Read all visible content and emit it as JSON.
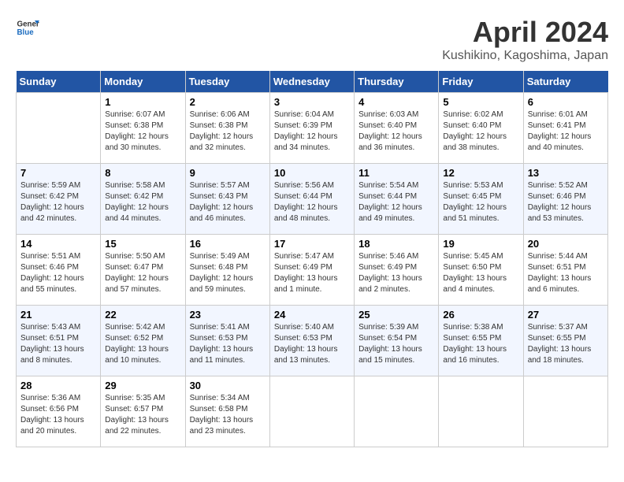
{
  "header": {
    "logo_general": "General",
    "logo_blue": "Blue",
    "title": "April 2024",
    "location": "Kushikino, Kagoshima, Japan"
  },
  "days_of_week": [
    "Sunday",
    "Monday",
    "Tuesday",
    "Wednesday",
    "Thursday",
    "Friday",
    "Saturday"
  ],
  "weeks": [
    [
      {
        "day": "",
        "info": ""
      },
      {
        "day": "1",
        "info": "Sunrise: 6:07 AM\nSunset: 6:38 PM\nDaylight: 12 hours\nand 30 minutes."
      },
      {
        "day": "2",
        "info": "Sunrise: 6:06 AM\nSunset: 6:38 PM\nDaylight: 12 hours\nand 32 minutes."
      },
      {
        "day": "3",
        "info": "Sunrise: 6:04 AM\nSunset: 6:39 PM\nDaylight: 12 hours\nand 34 minutes."
      },
      {
        "day": "4",
        "info": "Sunrise: 6:03 AM\nSunset: 6:40 PM\nDaylight: 12 hours\nand 36 minutes."
      },
      {
        "day": "5",
        "info": "Sunrise: 6:02 AM\nSunset: 6:40 PM\nDaylight: 12 hours\nand 38 minutes."
      },
      {
        "day": "6",
        "info": "Sunrise: 6:01 AM\nSunset: 6:41 PM\nDaylight: 12 hours\nand 40 minutes."
      }
    ],
    [
      {
        "day": "7",
        "info": "Sunrise: 5:59 AM\nSunset: 6:42 PM\nDaylight: 12 hours\nand 42 minutes."
      },
      {
        "day": "8",
        "info": "Sunrise: 5:58 AM\nSunset: 6:42 PM\nDaylight: 12 hours\nand 44 minutes."
      },
      {
        "day": "9",
        "info": "Sunrise: 5:57 AM\nSunset: 6:43 PM\nDaylight: 12 hours\nand 46 minutes."
      },
      {
        "day": "10",
        "info": "Sunrise: 5:56 AM\nSunset: 6:44 PM\nDaylight: 12 hours\nand 48 minutes."
      },
      {
        "day": "11",
        "info": "Sunrise: 5:54 AM\nSunset: 6:44 PM\nDaylight: 12 hours\nand 49 minutes."
      },
      {
        "day": "12",
        "info": "Sunrise: 5:53 AM\nSunset: 6:45 PM\nDaylight: 12 hours\nand 51 minutes."
      },
      {
        "day": "13",
        "info": "Sunrise: 5:52 AM\nSunset: 6:46 PM\nDaylight: 12 hours\nand 53 minutes."
      }
    ],
    [
      {
        "day": "14",
        "info": "Sunrise: 5:51 AM\nSunset: 6:46 PM\nDaylight: 12 hours\nand 55 minutes."
      },
      {
        "day": "15",
        "info": "Sunrise: 5:50 AM\nSunset: 6:47 PM\nDaylight: 12 hours\nand 57 minutes."
      },
      {
        "day": "16",
        "info": "Sunrise: 5:49 AM\nSunset: 6:48 PM\nDaylight: 12 hours\nand 59 minutes."
      },
      {
        "day": "17",
        "info": "Sunrise: 5:47 AM\nSunset: 6:49 PM\nDaylight: 13 hours\nand 1 minute."
      },
      {
        "day": "18",
        "info": "Sunrise: 5:46 AM\nSunset: 6:49 PM\nDaylight: 13 hours\nand 2 minutes."
      },
      {
        "day": "19",
        "info": "Sunrise: 5:45 AM\nSunset: 6:50 PM\nDaylight: 13 hours\nand 4 minutes."
      },
      {
        "day": "20",
        "info": "Sunrise: 5:44 AM\nSunset: 6:51 PM\nDaylight: 13 hours\nand 6 minutes."
      }
    ],
    [
      {
        "day": "21",
        "info": "Sunrise: 5:43 AM\nSunset: 6:51 PM\nDaylight: 13 hours\nand 8 minutes."
      },
      {
        "day": "22",
        "info": "Sunrise: 5:42 AM\nSunset: 6:52 PM\nDaylight: 13 hours\nand 10 minutes."
      },
      {
        "day": "23",
        "info": "Sunrise: 5:41 AM\nSunset: 6:53 PM\nDaylight: 13 hours\nand 11 minutes."
      },
      {
        "day": "24",
        "info": "Sunrise: 5:40 AM\nSunset: 6:53 PM\nDaylight: 13 hours\nand 13 minutes."
      },
      {
        "day": "25",
        "info": "Sunrise: 5:39 AM\nSunset: 6:54 PM\nDaylight: 13 hours\nand 15 minutes."
      },
      {
        "day": "26",
        "info": "Sunrise: 5:38 AM\nSunset: 6:55 PM\nDaylight: 13 hours\nand 16 minutes."
      },
      {
        "day": "27",
        "info": "Sunrise: 5:37 AM\nSunset: 6:55 PM\nDaylight: 13 hours\nand 18 minutes."
      }
    ],
    [
      {
        "day": "28",
        "info": "Sunrise: 5:36 AM\nSunset: 6:56 PM\nDaylight: 13 hours\nand 20 minutes."
      },
      {
        "day": "29",
        "info": "Sunrise: 5:35 AM\nSunset: 6:57 PM\nDaylight: 13 hours\nand 22 minutes."
      },
      {
        "day": "30",
        "info": "Sunrise: 5:34 AM\nSunset: 6:58 PM\nDaylight: 13 hours\nand 23 minutes."
      },
      {
        "day": "",
        "info": ""
      },
      {
        "day": "",
        "info": ""
      },
      {
        "day": "",
        "info": ""
      },
      {
        "day": "",
        "info": ""
      }
    ]
  ]
}
